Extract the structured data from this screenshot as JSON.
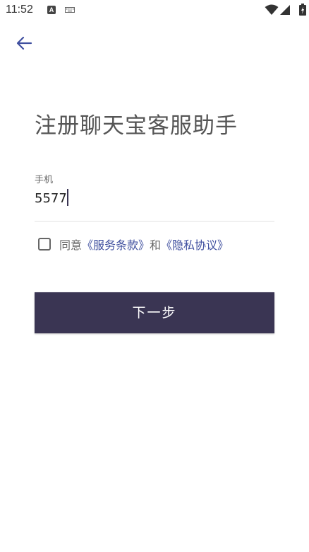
{
  "status_bar": {
    "time": "11:52",
    "icons": [
      "a-icon",
      "keyboard-icon",
      "wifi-icon",
      "signal-icon",
      "battery-icon"
    ]
  },
  "header": {
    "back_icon": "arrow-left-icon"
  },
  "title": "注册聊天宝客服助手",
  "phone": {
    "label": "手机",
    "value": "5577"
  },
  "agreement": {
    "prefix": "同意",
    "terms_link": "《服务条款》",
    "conjunction": "和",
    "privacy_link": "《隐私协议》",
    "checked": false
  },
  "next_button": {
    "label": "下一步"
  },
  "colors": {
    "accent": "#3a3553",
    "link": "#3f4f9f",
    "back_arrow": "#3f4f9f"
  }
}
